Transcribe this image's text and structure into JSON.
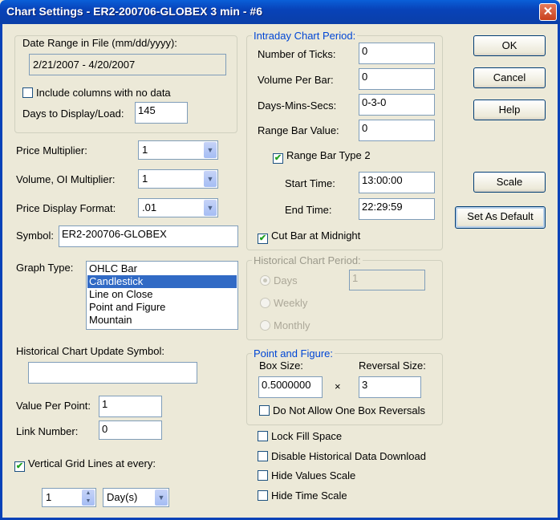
{
  "window": {
    "title": "Chart Settings - ER2-200706-GLOBEX  3 min  - #6",
    "close": "✕"
  },
  "date_range": {
    "label": "Date Range in File (mm/dd/yyyy):",
    "value": "2/21/2007 - 4/20/2007",
    "include_label": "Include columns with no data",
    "include_checked": false,
    "days_label": "Days to Display/Load:",
    "days_value": "145"
  },
  "price_multiplier": {
    "label": "Price Multiplier:",
    "value": "1"
  },
  "volume_multiplier": {
    "label": "Volume, OI Multiplier:",
    "value": "1"
  },
  "price_format": {
    "label": "Price Display Format:",
    "value": ".01"
  },
  "symbol": {
    "label": "Symbol:",
    "value": "ER2-200706-GLOBEX"
  },
  "graph_type": {
    "label": "Graph Type:",
    "options": [
      "OHLC Bar",
      "Candlestick",
      "Line on Close",
      "Point and Figure",
      "Mountain"
    ],
    "selected": "Candlestick"
  },
  "hist_update": {
    "label": "Historical Chart Update Symbol:",
    "value": ""
  },
  "value_per_point": {
    "label": "Value Per Point:",
    "value": "1"
  },
  "link_number": {
    "label": "Link Number:",
    "value": "0"
  },
  "grid": {
    "label": "Vertical Grid Lines at every:",
    "checked": true,
    "count": "1",
    "unit": "Day(s)"
  },
  "intraday": {
    "legend": "Intraday Chart Period:",
    "ticks_label": "Number of Ticks:",
    "ticks": "0",
    "volume_label": "Volume Per Bar:",
    "volume": "0",
    "dms_label": "Days-Mins-Secs:",
    "dms": "0-3-0",
    "range_label": "Range Bar Value:",
    "range": "0",
    "type2_label": "Range Bar Type 2",
    "start_label": "Start Time:",
    "start": "13:00:00",
    "end_label": "End Time:",
    "end": "22:29:59",
    "cut_label": "Cut Bar at Midnight"
  },
  "historical": {
    "legend": "Historical Chart Period:",
    "days": "Days",
    "days_value": "1",
    "weekly": "Weekly",
    "monthly": "Monthly"
  },
  "pf": {
    "legend": "Point and Figure:",
    "box_label": "Box Size:",
    "box": "0.5000000",
    "times": "×",
    "rev_label": "Reversal Size:",
    "rev": "3",
    "no_one_box": "Do Not Allow One Box Reversals"
  },
  "options": {
    "lock": "Lock Fill Space",
    "disable": "Disable Historical Data Download",
    "hide_values": "Hide Values Scale",
    "hide_time": "Hide Time Scale"
  },
  "buttons": {
    "ok": "OK",
    "cancel": "Cancel",
    "help": "Help",
    "scale": "Scale",
    "default": "Set As Default"
  },
  "check": "✔",
  "arrow": "▼"
}
